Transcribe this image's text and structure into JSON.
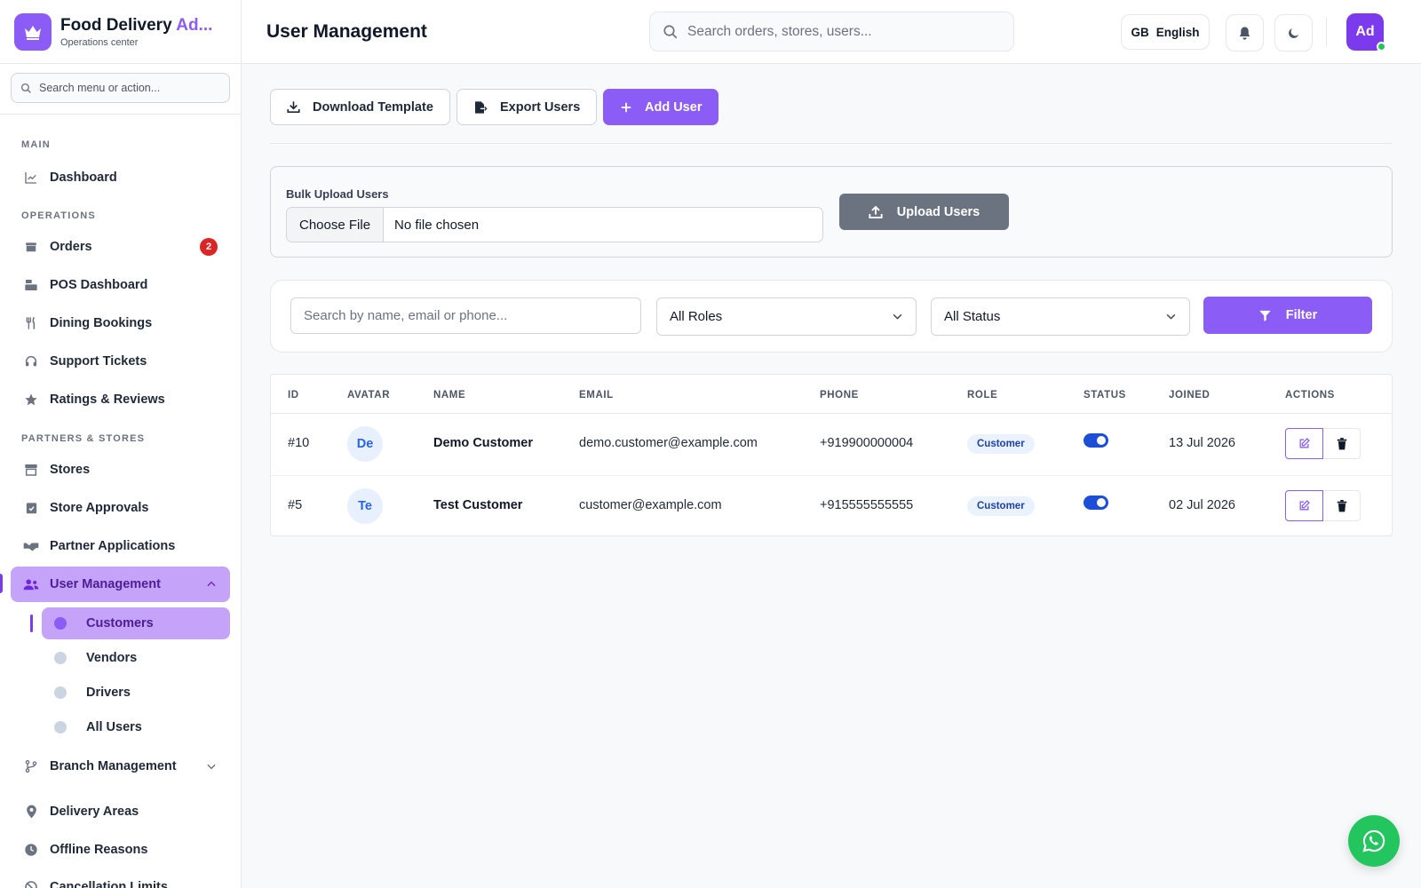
{
  "brand": {
    "title_main": "Food Delivery ",
    "title_accent": "Ad...",
    "subtitle": "Operations center"
  },
  "sidebar": {
    "search_placeholder": "Search menu or action...",
    "sections": {
      "main": "MAIN",
      "operations": "OPERATIONS",
      "partners": "PARTNERS & STORES"
    },
    "items": {
      "dashboard": "Dashboard",
      "orders": "Orders",
      "orders_badge": "2",
      "pos": "POS Dashboard",
      "dining": "Dining Bookings",
      "support": "Support Tickets",
      "ratings": "Ratings & Reviews",
      "stores": "Stores",
      "store_approvals": "Store Approvals",
      "partner_apps": "Partner Applications",
      "user_mgmt": "User Management",
      "branch_mgmt": "Branch Management",
      "delivery_areas": "Delivery Areas",
      "offline_reasons": "Offline Reasons",
      "cancellation": "Cancellation Limits"
    },
    "sub_items": {
      "customers": "Customers",
      "vendors": "Vendors",
      "drivers": "Drivers",
      "all_users": "All Users"
    }
  },
  "header": {
    "title": "User Management",
    "search_placeholder": "Search orders, stores, users...",
    "lang_code": "GB",
    "lang_label": "English",
    "avatar": "Ad"
  },
  "toolbar": {
    "download": "Download Template",
    "export": "Export Users",
    "add": "Add User"
  },
  "bulk": {
    "label": "Bulk Upload Users",
    "choose": "Choose File",
    "no_file": "No file chosen",
    "upload": "Upload Users"
  },
  "filters": {
    "search_placeholder": "Search by name, email or phone...",
    "role": "All Roles",
    "status": "All Status",
    "button": "Filter"
  },
  "table": {
    "headers": {
      "id": "ID",
      "avatar": "AVATAR",
      "name": "NAME",
      "email": "EMAIL",
      "phone": "PHONE",
      "role": "ROLE",
      "status": "STATUS",
      "joined": "JOINED",
      "actions": "ACTIONS"
    },
    "rows": [
      {
        "id": "#10",
        "avatar": "De",
        "name": "Demo Customer",
        "email": "demo.customer@example.com",
        "phone": "+919900000004",
        "role": "Customer",
        "joined": "13 Jul 2026",
        "active": true
      },
      {
        "id": "#5",
        "avatar": "Te",
        "name": "Test Customer",
        "email": "customer@example.com",
        "phone": "+915555555555",
        "role": "Customer",
        "joined": "02 Jul 2026",
        "active": true
      }
    ]
  },
  "colors": {
    "accent": "#8b5cf6",
    "toggle_on": "#1d4ed8",
    "badge": "#dc2626",
    "whatsapp": "#22c55e"
  }
}
